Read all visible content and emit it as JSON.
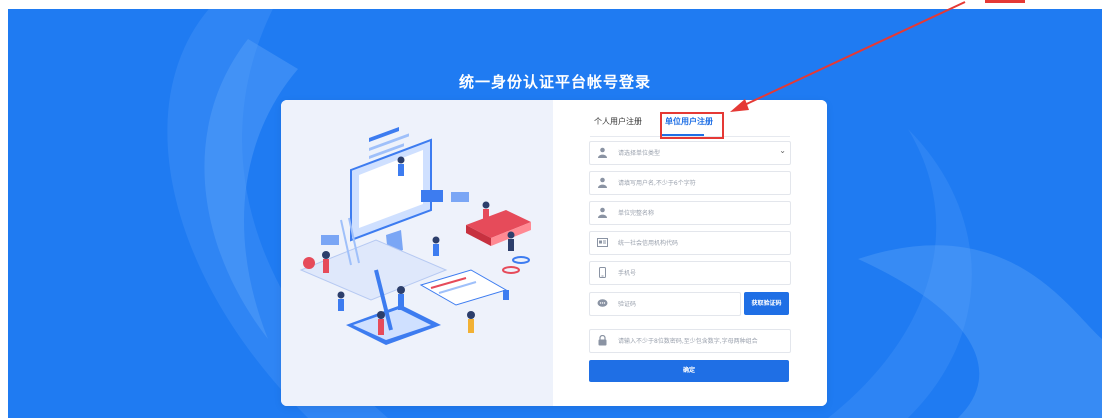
{
  "page": {
    "title": "统一身份认证平台帐号登录"
  },
  "tabs": [
    {
      "label": "个人用户注册",
      "active": false
    },
    {
      "label": "单位用户注册",
      "active": true
    }
  ],
  "form": {
    "unit_type": {
      "placeholder": "请选择单位类型",
      "icon": "user-icon"
    },
    "username": {
      "placeholder": "请填写用户名,不少于6个字符",
      "icon": "user-icon"
    },
    "unit_name": {
      "placeholder": "单位完整名称",
      "icon": "user-icon"
    },
    "credit_code": {
      "placeholder": "统一社会信用机构代码",
      "icon": "id-card-icon"
    },
    "phone": {
      "placeholder": "手机号",
      "icon": "phone-icon"
    },
    "captcha": {
      "placeholder": "验证码",
      "icon": "message-icon"
    },
    "password": {
      "placeholder": "请输入不少于8位数密码,至少包含数字,字母两种组合",
      "icon": "lock-icon"
    },
    "get_code_label": "获取验证码",
    "submit_label": "确定"
  },
  "colors": {
    "background": "#1f7bf2",
    "accent": "#1f6fe5",
    "annotation": "#e53935"
  }
}
